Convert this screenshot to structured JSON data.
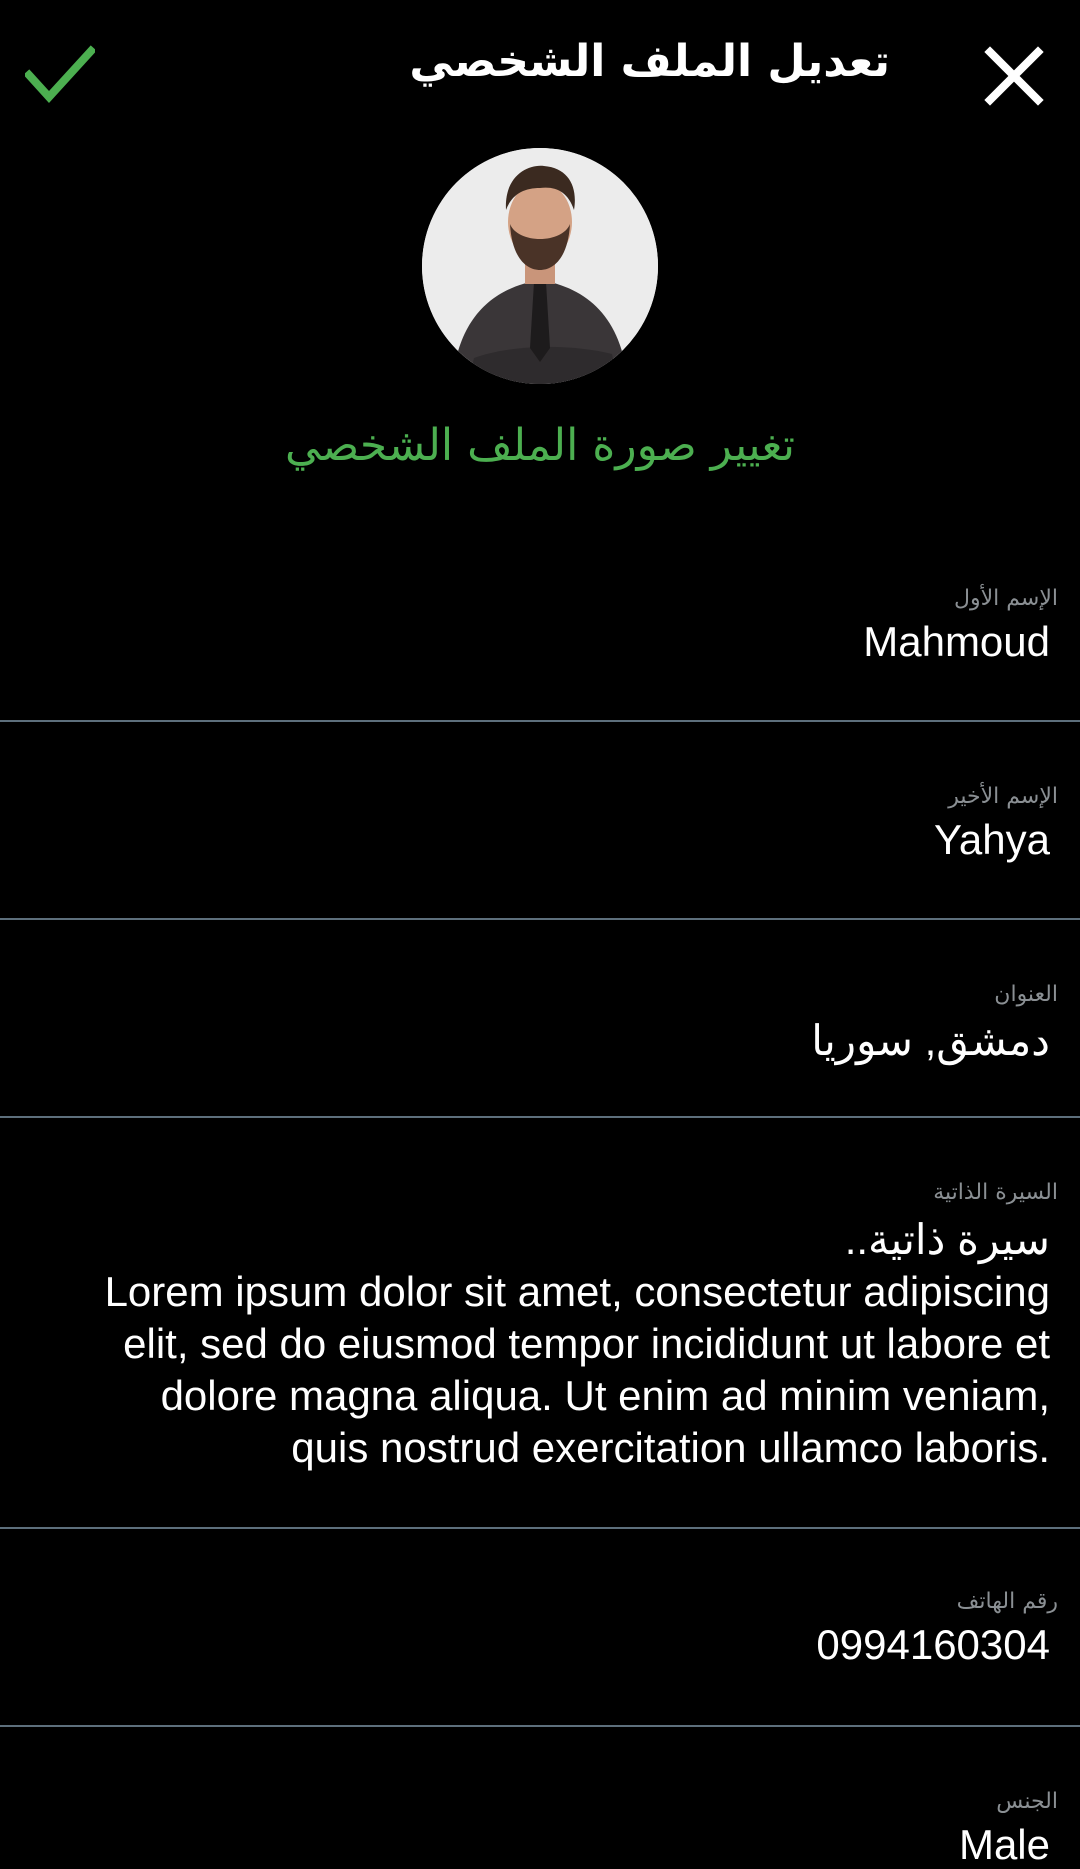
{
  "header": {
    "title": "تعديل الملف الشخصي",
    "save_icon": "check-icon",
    "close_icon": "close-icon"
  },
  "profile": {
    "change_photo_label": "تغيير صورة الملف الشخصي"
  },
  "fields": {
    "first_name": {
      "label": "الإسم الأول",
      "value": "Mahmoud"
    },
    "last_name": {
      "label": "الإسم الأخير",
      "value": "Yahya"
    },
    "address": {
      "label": "العنوان",
      "value": "دمشق, سوريا"
    },
    "bio": {
      "label": "السيرة الذاتية",
      "lines": [
        "سيرة ذاتية..",
        "Lorem ipsum dolor sit amet, consectetur adipiscing",
        "elit, sed do eiusmod tempor incididunt ut labore et",
        "dolore magna aliqua. Ut enim ad minim veniam,",
        "quis nostrud exercitation ullamco laboris."
      ]
    },
    "phone": {
      "label": "رقم الهاتف",
      "value": "0994160304"
    },
    "gender": {
      "label": "الجنس",
      "value": "Male"
    }
  },
  "colors": {
    "accent": "#4caf50",
    "divider": "#5d6f7c",
    "label": "#8a8f93",
    "background": "#000000"
  }
}
